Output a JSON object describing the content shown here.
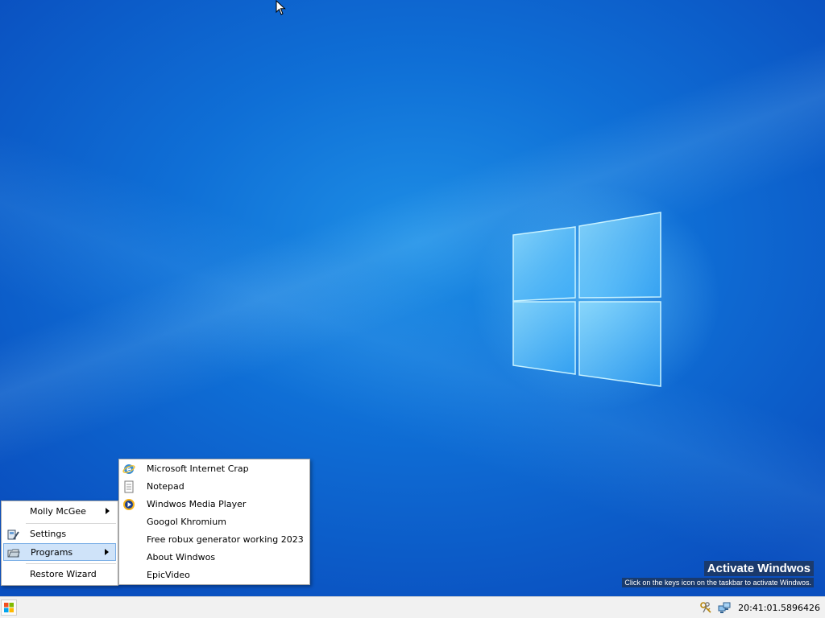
{
  "start_menu": {
    "items": [
      {
        "label": "Molly McGee",
        "has_submenu": true
      },
      {
        "label": "Settings",
        "icon": "settings-icon"
      },
      {
        "label": "Programs",
        "icon": "programs-folder-icon",
        "has_submenu": true,
        "highlighted": true
      },
      {
        "label": "Restore Wizard"
      }
    ]
  },
  "programs_menu": {
    "items": [
      {
        "label": "Microsoft Internet Crap",
        "icon": "internet-explorer-icon"
      },
      {
        "label": "Notepad",
        "icon": "notepad-icon"
      },
      {
        "label": "Windwos Media Player",
        "icon": "media-player-icon"
      },
      {
        "label": "Googol Khromium"
      },
      {
        "label": "Free robux generator working 2023"
      },
      {
        "label": "About Windwos"
      },
      {
        "label": "EpicVideo"
      }
    ]
  },
  "watermark": {
    "title": "Activate Windwos",
    "subtitle": "Click on the keys icon on the taskbar to activate Windwos."
  },
  "taskbar": {
    "clock": "20:41:01.5896426",
    "tray_icons": [
      "keys-icon",
      "network-icon"
    ]
  },
  "colors": {
    "desktop_blue": "#0f6fd6",
    "menu_highlight": "#cfe3f9",
    "taskbar": "#f1f1f1"
  }
}
